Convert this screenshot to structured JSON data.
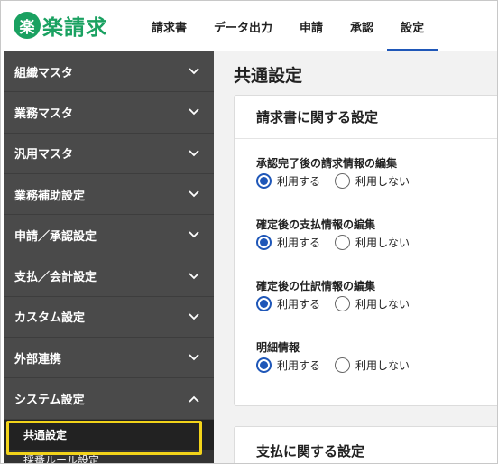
{
  "app": {
    "logo_mark": "楽",
    "logo_text": "楽請求"
  },
  "nav": {
    "items": [
      {
        "label": "請求書"
      },
      {
        "label": "データ出力"
      },
      {
        "label": "申請"
      },
      {
        "label": "承認"
      },
      {
        "label": "設定"
      }
    ],
    "active": "設定"
  },
  "sidebar": {
    "items": [
      {
        "label": "組織マスタ",
        "icon": "chevron-down-icon"
      },
      {
        "label": "業務マスタ",
        "icon": "chevron-down-icon"
      },
      {
        "label": "汎用マスタ",
        "icon": "chevron-down-icon"
      },
      {
        "label": "業務補助設定",
        "icon": "chevron-down-icon"
      },
      {
        "label": "申請／承認設定",
        "icon": "chevron-down-icon"
      },
      {
        "label": "支払／会計設定",
        "icon": "chevron-down-icon"
      },
      {
        "label": "カスタム設定",
        "icon": "chevron-down-icon"
      },
      {
        "label": "外部連携",
        "icon": "chevron-down-icon"
      },
      {
        "label": "システム設定",
        "icon": "chevron-up-icon"
      }
    ],
    "sub_items": [
      {
        "label": "共通設定",
        "selected": true
      },
      {
        "label": "採番ルール設定"
      }
    ],
    "highlight_color": "#f2d31a"
  },
  "main": {
    "page_title": "共通設定",
    "sections": [
      {
        "title": "請求書に関する設定",
        "settings": [
          {
            "label": "承認完了後の請求情報の編集",
            "options": [
              "利用する",
              "利用しない"
            ],
            "selected": "利用する"
          },
          {
            "label": "確定後の支払情報の編集",
            "options": [
              "利用する",
              "利用しない"
            ],
            "selected": "利用する"
          },
          {
            "label": "確定後の仕訳情報の編集",
            "options": [
              "利用する",
              "利用しない"
            ],
            "selected": "利用する"
          },
          {
            "label": "明細情報",
            "options": [
              "利用する",
              "利用しない"
            ],
            "selected": "利用する"
          }
        ]
      },
      {
        "title": "支払に関する設定",
        "settings": []
      }
    ]
  },
  "colors": {
    "brand": "#1aa161",
    "accent": "#1f57b8",
    "sidebar_bg": "#4a4a4a"
  }
}
